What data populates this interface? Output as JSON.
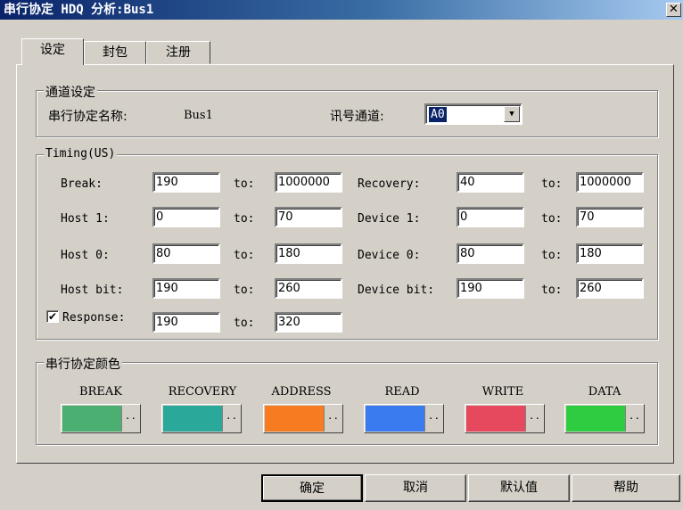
{
  "window": {
    "title": "串行协定 HDQ 分析:Bus1",
    "close": "✕"
  },
  "tabs": [
    "设定",
    "封包",
    "注册"
  ],
  "channel_group": {
    "title": "通道设定",
    "name_label": "串行协定名称:",
    "name_value": "Bus1",
    "channel_label": "讯号通道:",
    "channel_value": "A0"
  },
  "timing": {
    "title": "Timing(US)",
    "to_label": "to:",
    "left": [
      {
        "label": "Break:",
        "from": "190",
        "to": "1000000"
      },
      {
        "label": "Host 1:",
        "from": "0",
        "to": "70"
      },
      {
        "label": "Host 0:",
        "from": "80",
        "to": "180"
      },
      {
        "label": "Host bit:",
        "from": "190",
        "to": "260"
      }
    ],
    "right": [
      {
        "label": "Recovery:",
        "from": "40",
        "to": "1000000"
      },
      {
        "label": "Device 1:",
        "from": "0",
        "to": "70"
      },
      {
        "label": "Device 0:",
        "from": "80",
        "to": "180"
      },
      {
        "label": "Device bit:",
        "from": "190",
        "to": "260"
      }
    ],
    "response": {
      "label": "Response:",
      "checked": true,
      "check_glyph": "✔",
      "from": "190",
      "to": "320"
    }
  },
  "colors": {
    "title": "串行协定颜色",
    "dots": "··",
    "items": [
      {
        "label": "BREAK",
        "color": "#4caf72"
      },
      {
        "label": "RECOVERY",
        "color": "#2aa89a"
      },
      {
        "label": "ADDRESS",
        "color": "#f77b20"
      },
      {
        "label": "READ",
        "color": "#3a7cf0"
      },
      {
        "label": "WRITE",
        "color": "#e6485e"
      },
      {
        "label": "DATA",
        "color": "#2ecc40"
      }
    ]
  },
  "buttons": {
    "ok": "确定",
    "cancel": "取消",
    "default": "默认值",
    "help": "帮助"
  }
}
